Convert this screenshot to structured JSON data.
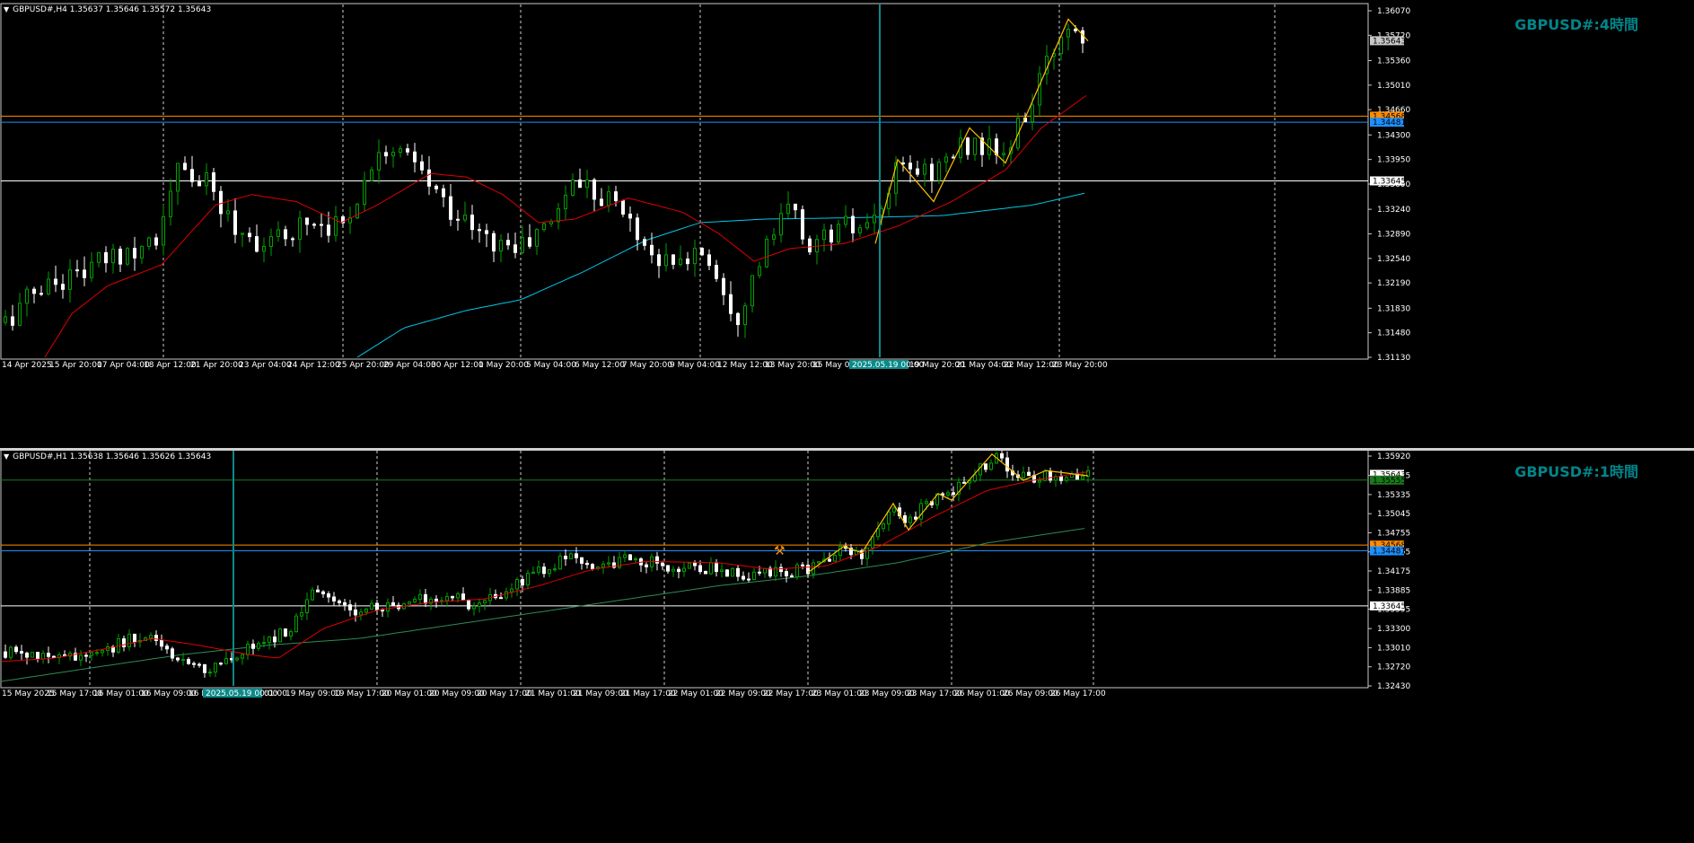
{
  "colors": {
    "background": "#000000",
    "bull": "#00a000",
    "bear": "#ffffff",
    "ma_fast": "#e00000",
    "ma_slow_top": "#00c8e8",
    "ma_slow_bottom": "#2e8b57",
    "zigzag": "#ffc000",
    "hline_white": "#ffffff",
    "hline_orange": "#ff8c00",
    "hline_blue": "#1e90ff",
    "hline_green": "#1a7a1a",
    "vline": "#0a8a8a",
    "watermark": "#00868b"
  },
  "top_pane": {
    "header": "GBPUSD#,H4  1.35637 1.35646 1.35572 1.35643",
    "watermark": "GBPUSD#:4時間",
    "price_axis": [
      "1.36070",
      "1.35720",
      "1.35360",
      "1.35010",
      "1.34660",
      "1.34300",
      "1.33950",
      "1.33600",
      "1.33240",
      "1.32890",
      "1.32540",
      "1.32190",
      "1.31830",
      "1.31480",
      "1.31130"
    ],
    "price_min": 1.3113,
    "price_max": 1.3607,
    "current_price": "1.35643",
    "hline_white": "1.33645",
    "hline_orange": "1.34568",
    "hline_blue": "1.34481",
    "time_axis": [
      "14 Apr 2025",
      "15 Apr 20:00",
      "17 Apr 04:00",
      "18 Apr 12:00",
      "21 Apr 20:00",
      "23 Apr 04:00",
      "24 Apr 12:00",
      "25 Apr 20:00",
      "29 Apr 04:00",
      "30 Apr 12:00",
      "1 May 20:00",
      "5 May 04:00",
      "6 May 12:00",
      "7 May 20:00",
      "9 May 04:00",
      "12 May 12:00",
      "13 May 20:00",
      "15 May 04:00",
      "19 May 20:00",
      "21 May 04:00",
      "22 May 12:00",
      "23 May 20:00"
    ],
    "cursor_time_label": "2025.05.19 00:00"
  },
  "bottom_pane": {
    "header": "GBPUSD#,H1  1.35638 1.35646 1.35626 1.35643",
    "watermark": "GBPUSD#:1時間",
    "price_axis": [
      "1.35920",
      "1.35625",
      "1.35335",
      "1.35045",
      "1.34755",
      "1.34465",
      "1.34175",
      "1.33885",
      "1.33595",
      "1.33300",
      "1.33010",
      "1.32720",
      "1.32430"
    ],
    "price_min": 1.3243,
    "price_max": 1.3592,
    "current_price": "1.35643",
    "hline_green": "1.35555",
    "hline_white": "1.33645",
    "hline_orange": "1.34568",
    "hline_blue": "1.34481",
    "time_axis": [
      "15 May 2025",
      "15 May 17:00",
      "16 May 01:00",
      "16 May 09:00",
      "16 M",
      "01:00",
      "19 May 09:00",
      "19 May 17:00",
      "20 May 01:00",
      "20 May 09:00",
      "20 May 17:00",
      "21 May 01:00",
      "21 May 09:00",
      "21 May 17:00",
      "22 May 01:00",
      "22 May 09:00",
      "22 May 17:00",
      "23 May 01:00",
      "23 May 09:00",
      "23 May 17:00",
      "26 May 01:00",
      "26 May 09:00",
      "26 May 17:00"
    ],
    "cursor_time_label": "2025.05.19 00:00"
  }
}
